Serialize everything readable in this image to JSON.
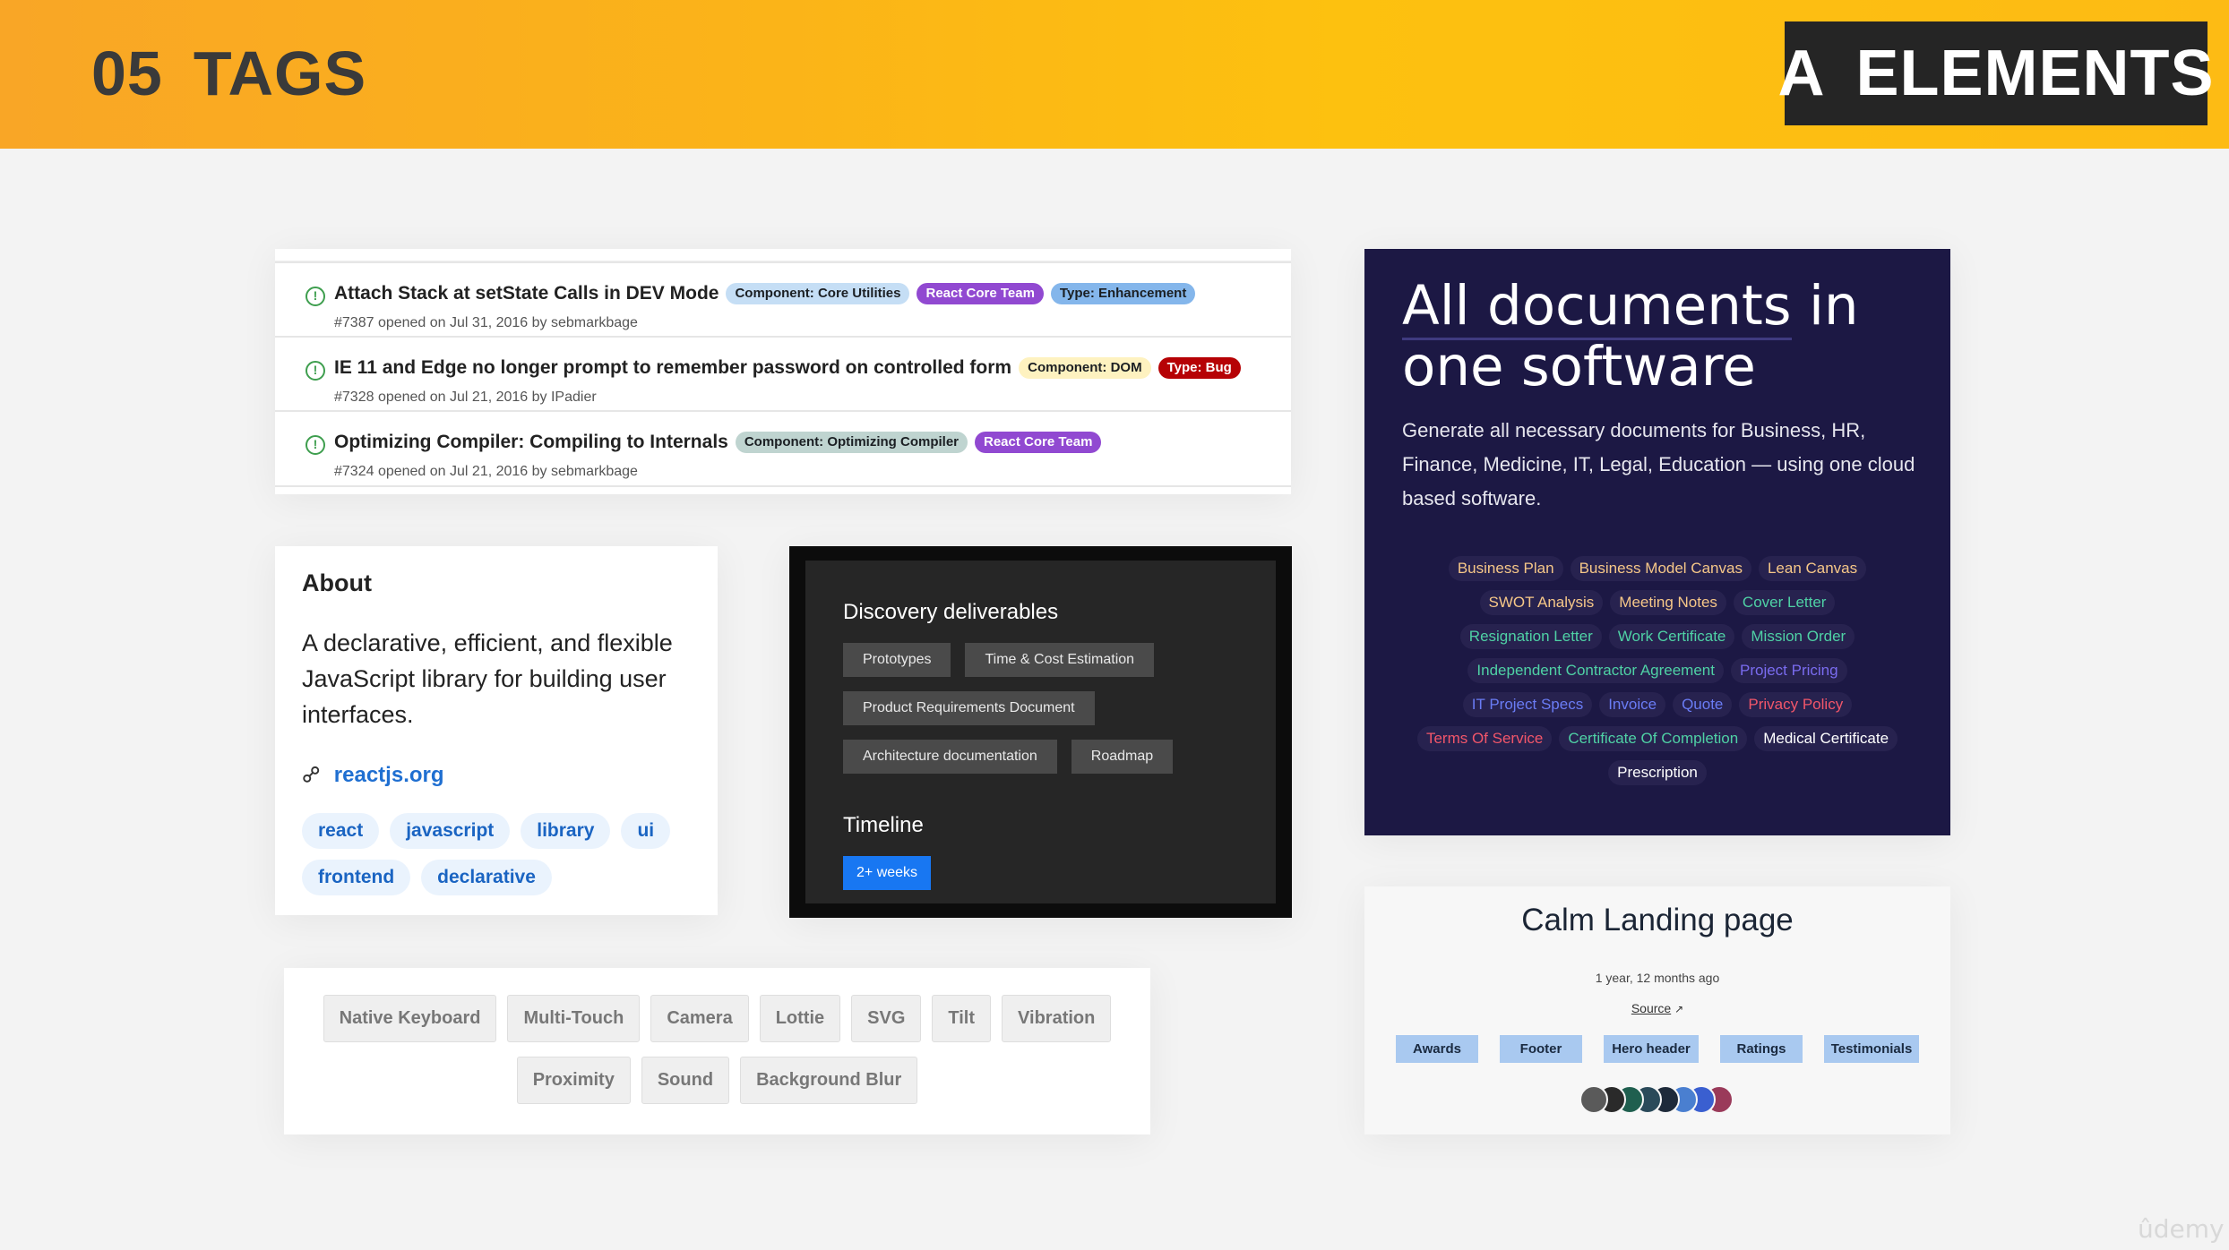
{
  "header": {
    "number": "05",
    "title": "TAGS",
    "brand_a": "A",
    "brand_word": "ELEMENTS"
  },
  "issues": [
    {
      "title": "Attach Stack at setState Calls in DEV Mode",
      "meta": "#7387 opened on Jul 31, 2016 by sebmarkbage",
      "labels": [
        {
          "text": "Component: Core Utilities",
          "bg": "#c5def5",
          "fg": "#1b1f23"
        },
        {
          "text": "React Core Team",
          "bg": "#9149d1",
          "fg": "#ffffff"
        },
        {
          "text": "Type: Enhancement",
          "bg": "#84b6eb",
          "fg": "#1b1f23"
        }
      ]
    },
    {
      "title": "IE 11 and Edge no longer prompt to remember password on controlled form",
      "meta": "#7328 opened on Jul 21, 2016 by IPadier",
      "labels": [
        {
          "text": "Component: DOM",
          "bg": "#fef2c0",
          "fg": "#1b1f23"
        },
        {
          "text": "Type: Bug",
          "bg": "#b60205",
          "fg": "#ffffff"
        }
      ]
    },
    {
      "title": "Optimizing Compiler: Compiling to Internals",
      "meta": "#7324 opened on Jul 21, 2016 by sebmarkbage",
      "labels": [
        {
          "text": "Component: Optimizing Compiler",
          "bg": "#bfd4d0",
          "fg": "#1b1f23"
        },
        {
          "text": "React Core Team",
          "bg": "#9149d1",
          "fg": "#ffffff"
        }
      ]
    }
  ],
  "about": {
    "heading": "About",
    "description": "A declarative, efficient, and flexible JavaScript library for building user interfaces.",
    "link_icon": "link-icon",
    "url": "reactjs.org",
    "topics": [
      "react",
      "javascript",
      "library",
      "ui",
      "frontend",
      "declarative"
    ]
  },
  "discovery": {
    "heading": "Discovery deliverables",
    "chips": [
      "Prototypes",
      "Time & Cost Estimation",
      "Product Requirements Document",
      "Architecture documentation",
      "Roadmap"
    ],
    "timeline_heading": "Timeline",
    "timeline_badge": "2+ weeks"
  },
  "features": {
    "chips": [
      "Native Keyboard",
      "Multi-Touch",
      "Camera",
      "Lottie",
      "SVG",
      "Tilt",
      "Vibration",
      "Proximity",
      "Sound",
      "Background Blur"
    ]
  },
  "documents": {
    "heading_part1": "All documents",
    "heading_part2": " in one software",
    "paragraph": "Generate all necessary documents for Business, HR, Finance, Medicine, IT, Legal, Education — using one cloud based software.",
    "tags": [
      {
        "text": "Business Plan",
        "color": "#f6c788"
      },
      {
        "text": "Business Model Canvas",
        "color": "#f6c788"
      },
      {
        "text": "Lean Canvas",
        "color": "#f6c788"
      },
      {
        "text": "SWOT Analysis",
        "color": "#f6c788"
      },
      {
        "text": "Meeting Notes",
        "color": "#f6c788"
      },
      {
        "text": "Cover Letter",
        "color": "#4fd1a5"
      },
      {
        "text": "Resignation Letter",
        "color": "#4fd1a5"
      },
      {
        "text": "Work Certificate",
        "color": "#4fd1a5"
      },
      {
        "text": "Mission Order",
        "color": "#4fd1a5"
      },
      {
        "text": "Independent Contractor Agreement",
        "color": "#4fd1a5"
      },
      {
        "text": "Project Pricing",
        "color": "#7a6cf0"
      },
      {
        "text": "IT Project Specs",
        "color": "#6a7cf5"
      },
      {
        "text": "Invoice",
        "color": "#6a7cf5"
      },
      {
        "text": "Quote",
        "color": "#6a7cf5"
      },
      {
        "text": "Privacy Policy",
        "color": "#f2566a"
      },
      {
        "text": "Terms Of Service",
        "color": "#f2566a"
      },
      {
        "text": "Certificate Of Completion",
        "color": "#4fd1a5"
      },
      {
        "text": "Medical Certificate",
        "color": "#ffffff"
      },
      {
        "text": "Prescription",
        "color": "#ffffff"
      }
    ]
  },
  "calm": {
    "heading": "Calm Landing page",
    "date": "1 year, 12 months ago",
    "source": "Source",
    "source_icon": "external-link-icon",
    "chips": [
      "Awards",
      "Footer",
      "Hero header",
      "Ratings",
      "Testimonials"
    ],
    "palette": [
      "#5a5a5a",
      "#2a2a2a",
      "#1f5f4f",
      "#2a4a5a",
      "#1e2a3a",
      "#4a7fd0",
      "#3a5fd0",
      "#9a3a5a"
    ]
  },
  "watermark": "ûdemy"
}
